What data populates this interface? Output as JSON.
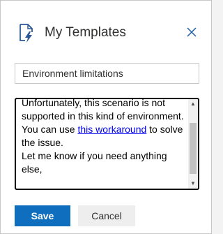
{
  "header": {
    "title": "My Templates",
    "icon": "document-lightning-icon",
    "close_icon": "close-icon"
  },
  "template_name": {
    "value": "Environment limitations"
  },
  "editor": {
    "line1": "Unfortunately, this scenario is not supported in this kind of environment.",
    "text_before_link": "You can use ",
    "link_text": "this workaround",
    "text_after_link": " to solve the issue.",
    "line3": "Let me know if you need anything else,"
  },
  "buttons": {
    "save_label": "Save",
    "cancel_label": "Cancel"
  },
  "colors": {
    "accent": "#106ebe",
    "link": "#0000ee",
    "icon": "#2b5797",
    "close": "#1e5fa8"
  }
}
